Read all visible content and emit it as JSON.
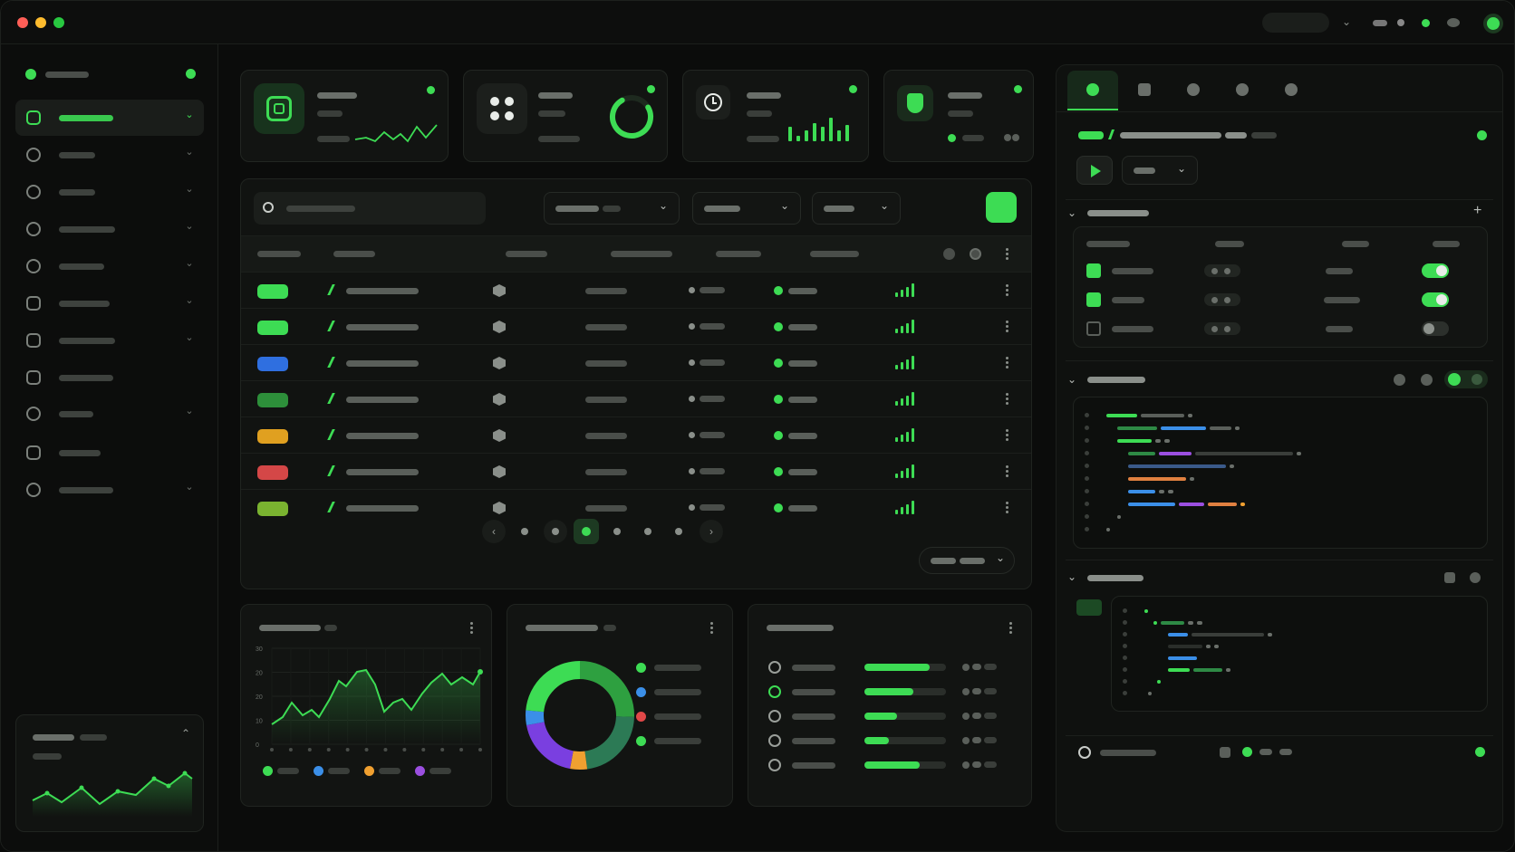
{
  "window": {
    "controls": [
      "close",
      "minimize",
      "maximize"
    ]
  },
  "theme": {
    "accent": "#3ddc54",
    "background": "#0b0c0b",
    "panel": "#121412"
  },
  "sidebar": {
    "items": [
      {
        "icon": "square-icon",
        "active": true,
        "expandable": true
      },
      {
        "icon": "gear-icon",
        "expandable": true
      },
      {
        "icon": "gear-icon",
        "expandable": true
      },
      {
        "icon": "settings-dial-icon",
        "expandable": true
      },
      {
        "icon": "link-icon",
        "expandable": true
      },
      {
        "icon": "camera-icon",
        "expandable": true
      },
      {
        "icon": "chart-icon",
        "expandable": true
      },
      {
        "icon": "box-icon",
        "expandable": false
      },
      {
        "icon": "hexagon-icon",
        "expandable": true
      },
      {
        "icon": "box-icon",
        "expandable": false
      },
      {
        "icon": "hexagon-icon",
        "expandable": true
      }
    ]
  },
  "stats": [
    {
      "icon": "chip-icon"
    },
    {
      "icon": "apps-icon",
      "progress": 0.75
    },
    {
      "icon": "clock-icon"
    },
    {
      "icon": "shield-icon"
    }
  ],
  "table": {
    "tag_colors": [
      "#3ddc54",
      "#3ddc54",
      "#2f6fe0",
      "#2d8f3a",
      "#e0a020",
      "#d44747",
      "#7ab330"
    ],
    "pages": 7,
    "current_page": 3
  },
  "charts": {
    "line": {
      "y_ticks": [
        "30",
        "20",
        "20",
        "10",
        "0"
      ],
      "legend_colors": [
        "#3ddc54",
        "#3b8fe8",
        "#f0a030",
        "#9b4fe0"
      ]
    },
    "donut": {
      "legend_colors": [
        "#3ddc54",
        "#3b8fe8",
        "#e04848",
        "#3ddc54"
      ]
    },
    "progress": {
      "values": [
        0.8,
        0.6,
        0.4,
        0.3,
        0.68
      ]
    }
  },
  "right_panel": {
    "tabs": 5,
    "toggles": [
      true,
      true,
      false
    ],
    "checkboxes": [
      true,
      true,
      false
    ]
  }
}
